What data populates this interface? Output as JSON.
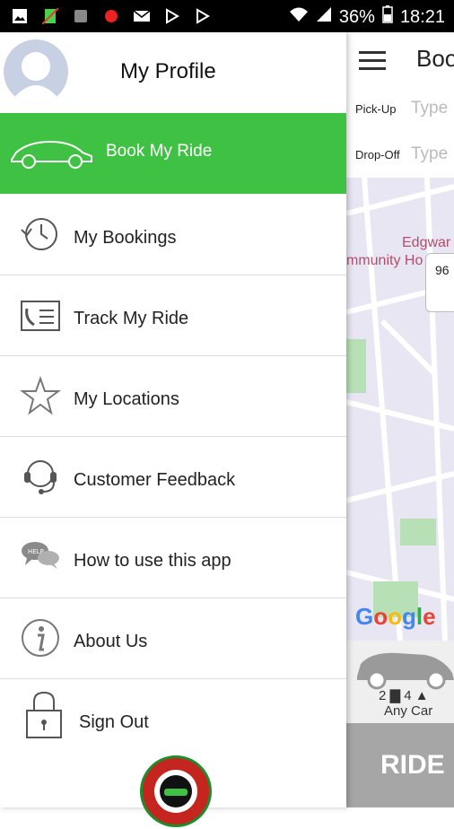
{
  "status_bar": {
    "battery": "36%",
    "time": "18:21"
  },
  "drawer": {
    "profile_title": "My Profile",
    "items": [
      {
        "label": "Book My Ride",
        "icon": "car-icon",
        "active": true
      },
      {
        "label": "My Bookings",
        "icon": "history-icon"
      },
      {
        "label": "Track My Ride",
        "icon": "contact-card-icon"
      },
      {
        "label": "My Locations",
        "icon": "star-icon"
      },
      {
        "label": "Customer Feedback",
        "icon": "headset-icon"
      },
      {
        "label": "How to use this app",
        "icon": "help-chat-icon"
      },
      {
        "label": "About Us",
        "icon": "info-icon"
      },
      {
        "label": "Sign Out",
        "icon": "lock-icon"
      }
    ]
  },
  "app": {
    "title": "Boo",
    "pickup_label": "Pick-Up",
    "pickup_placeholder": "Type",
    "dropoff_label": "Drop-Off",
    "dropoff_placeholder": "Type",
    "map_label_1": "Edgwar",
    "map_label_2": "mmunity Ho",
    "pin_text": "96",
    "google": "Google",
    "car_counts": "2 ▇ 4 ▲",
    "car_type": "Any Car",
    "ride_button": "RIDE N"
  },
  "colors": {
    "accent": "#3fc243",
    "ride_button": "#a6a6a6",
    "map": "#e9e6f3"
  }
}
